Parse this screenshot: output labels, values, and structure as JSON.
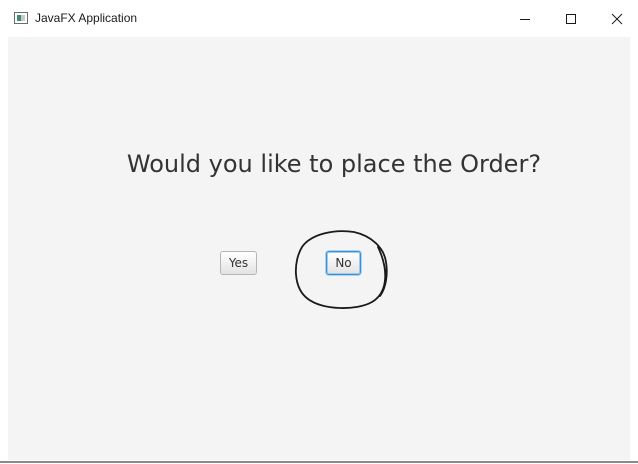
{
  "window": {
    "title": "JavaFX Application",
    "controls": {
      "minimize_icon": "minimize-icon",
      "maximize_icon": "maximize-icon",
      "close_icon": "close-icon"
    }
  },
  "dialog": {
    "question": "Would you like to place the Order?",
    "yes_label": "Yes",
    "no_label": "No",
    "focused_button": "No"
  },
  "colors": {
    "content_background": "#f4f4f4",
    "focus_ring": "#3c8fd0",
    "annotation_stroke": "#1a1a1a"
  }
}
